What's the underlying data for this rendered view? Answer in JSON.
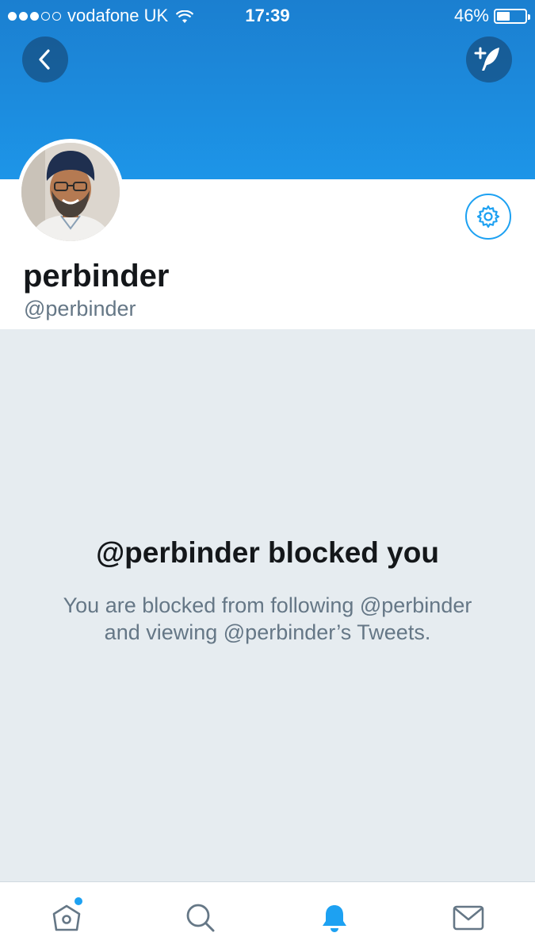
{
  "status_bar": {
    "carrier": "vodafone UK",
    "time": "17:39",
    "battery_percent": "46%",
    "battery_level": 0.46,
    "signal_bars": 3,
    "signal_total": 5
  },
  "header": {
    "back_icon": "chevron-left-icon",
    "compose_icon": "compose-tweet-icon"
  },
  "profile": {
    "display_name": "perbinder",
    "handle": "@perbinder",
    "settings_icon": "gear-icon"
  },
  "blocked": {
    "title": "@perbinder blocked you",
    "description": "You are blocked from following @perbinder and viewing @perbinder’s Tweets."
  },
  "tab_bar": {
    "tabs": [
      {
        "name": "home",
        "icon": "home-icon",
        "active": false,
        "has_unread": true
      },
      {
        "name": "search",
        "icon": "search-icon",
        "active": false
      },
      {
        "name": "notifications",
        "icon": "bell-icon",
        "active": true
      },
      {
        "name": "messages",
        "icon": "envelope-icon",
        "active": false
      }
    ]
  },
  "colors": {
    "brand_blue": "#1da1f2",
    "banner_top": "#1b7fd0",
    "banner_bottom": "#1d95e8",
    "background": "#e6ecf0",
    "text_primary": "#14171a",
    "text_secondary": "#657786"
  }
}
